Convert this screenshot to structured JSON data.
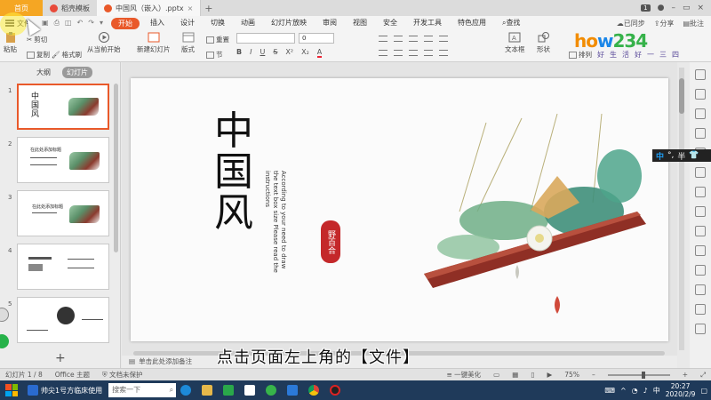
{
  "tabs": [
    {
      "label": "首页"
    },
    {
      "label": "稻壳模板"
    },
    {
      "label": "中国风（嵌入）.pptx"
    }
  ],
  "tabbar_right": {
    "badge": "1"
  },
  "menubar": {
    "file_label": "文件",
    "items": [
      "开始",
      "插入",
      "设计",
      "切换",
      "动画",
      "幻灯片放映",
      "审阅",
      "视图",
      "安全",
      "开发工具",
      "特色应用"
    ],
    "search_label": "查找",
    "sync_label": "已同步",
    "share_label": "分享",
    "comment_label": "批注"
  },
  "ribbon": {
    "paste": "粘贴",
    "cut": "剪切",
    "copy": "复制",
    "format_painter": "格式刷",
    "play_from_current": "从当前开始",
    "new_slide": "新建幻灯片",
    "layout": "版式",
    "section": "节",
    "reset": "重置",
    "font_size": "0",
    "textbox": "文本框",
    "shape": "形状",
    "arrange": "排列"
  },
  "logo": {
    "title_a": "ho",
    "title_b": "w",
    "title_c": "234",
    "subtitle": "好生活好一三四"
  },
  "left_panel": {
    "tab_outline": "大纲",
    "tab_slides": "幻灯片",
    "slides": [
      {
        "num": "1",
        "text": "中国风"
      },
      {
        "num": "2",
        "text": "在此处添加标题"
      },
      {
        "num": "3",
        "text": "在此处添加标题"
      },
      {
        "num": "4",
        "text": ""
      },
      {
        "num": "5",
        "text": ""
      }
    ],
    "add": "+"
  },
  "slide": {
    "title_chars": [
      "中",
      "国",
      "风"
    ],
    "vertical_text": "According to your need to draw the text box size Please read the instructions",
    "seal_text": "野百合"
  },
  "notes_hint": "单击此处添加备注",
  "ime": {
    "lang": "中",
    "mode": "°,",
    "width": "半"
  },
  "subtitle": "点击页面左上角的【文件】",
  "statusbar": {
    "slide_count": "幻灯片 1 / 8",
    "theme": "Office 主题",
    "protection": "文档未保护",
    "beautify": "一键美化",
    "zoom": "75%",
    "zoom_fraction": 0.75
  },
  "taskbar": {
    "app1": "帅尖1号方临床使用",
    "search": "搜索一下",
    "tray_lang": "中",
    "time": "20:27",
    "date": "2020/2/9"
  },
  "colors": {
    "accent": "#e9592a",
    "home_tab": "#f5a623",
    "taskbar": "#1f3a5a"
  }
}
